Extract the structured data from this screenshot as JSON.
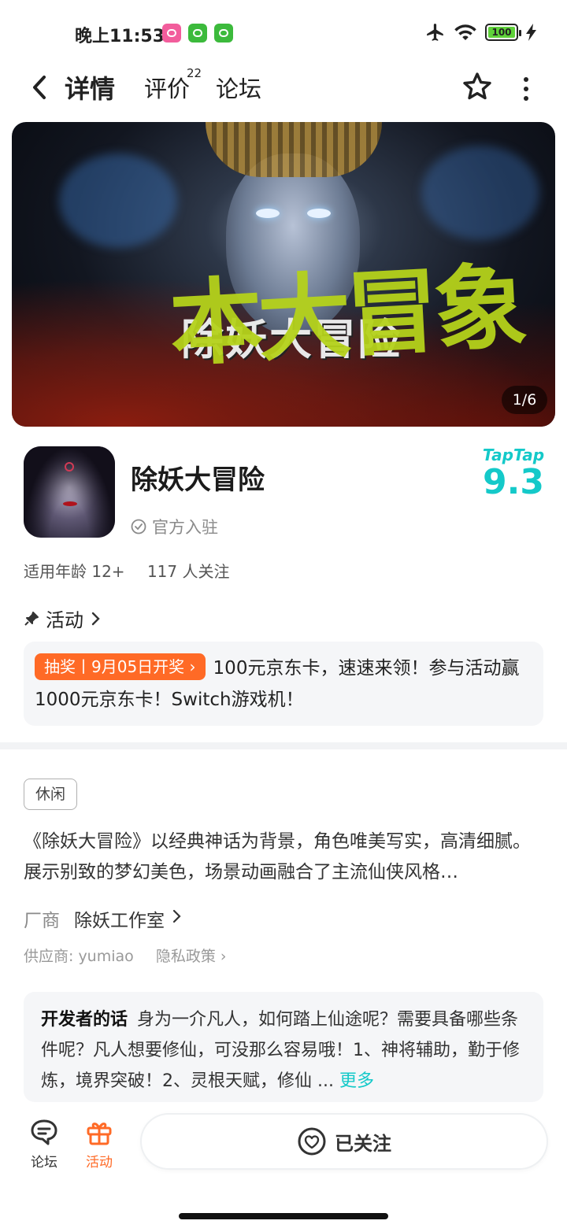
{
  "status_bar": {
    "time": "晚上11:53",
    "battery": "100"
  },
  "nav": {
    "tabs": [
      {
        "label": "详情",
        "active": true
      },
      {
        "label": "评价",
        "badge": "22"
      },
      {
        "label": "论坛"
      }
    ]
  },
  "banner": {
    "title_text": "除妖大冒险",
    "overlay_text": "本大冒象",
    "counter": "1/6"
  },
  "game": {
    "title": "除妖大冒险",
    "official": "官方入驻",
    "rating_brand": "TapTap",
    "rating": "9.3",
    "age": "适用年龄 12+",
    "followers": "117 人关注"
  },
  "activity": {
    "heading": "活动",
    "badge": "抽奖丨9月05日开奖",
    "text": "100元京东卡，速速来领！参与活动赢1000元京东卡！Switch游戏机！"
  },
  "details": {
    "tag": "休闲",
    "description": "《除妖大冒险》以经典神话为背景，角色唯美写实，高清细腻。展示别致的梦幻美色，场景动画融合了主流仙侠风格…",
    "vendor_label": "厂商",
    "vendor_value": "除妖工作室",
    "supplier": "供应商: yumiao",
    "privacy": "隐私政策"
  },
  "developer": {
    "label": "开发者的话",
    "text": "身为一介凡人，如何踏上仙途呢？需要具备哪些条件呢？凡人想要修仙，可没那么容易哦！1、神将辅助，勤于修炼，境界突破！2、灵根天赋，修仙 ...",
    "more": "更多"
  },
  "bottom_bar": {
    "forum": "论坛",
    "activity": "活动",
    "follow": "已关注"
  },
  "colors": {
    "accent": "#14c9c9",
    "orange": "#ff6a26"
  }
}
